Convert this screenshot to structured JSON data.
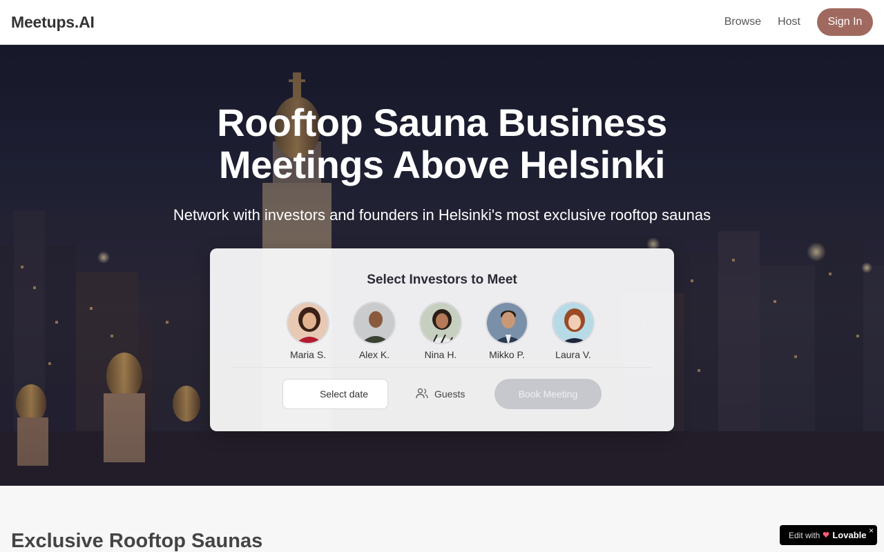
{
  "header": {
    "brand": "Meetups.AI",
    "nav": {
      "browse": "Browse",
      "host": "Host",
      "signin": "Sign In"
    }
  },
  "hero": {
    "title_line1": "Rooftop Sauna Business",
    "title_line2": "Meetings Above Helsinki",
    "subtitle": "Network with investors and founders in Helsinki's most exclusive rooftop saunas"
  },
  "booking": {
    "title": "Select Investors to Meet",
    "investors": [
      {
        "name": "Maria S."
      },
      {
        "name": "Alex K."
      },
      {
        "name": "Nina H."
      },
      {
        "name": "Mikko P."
      },
      {
        "name": "Laura V."
      }
    ],
    "date_label": "Select date",
    "guests_label": "Guests",
    "book_label": "Book Meeting"
  },
  "section": {
    "title": "Exclusive Rooftop Saunas"
  },
  "badge": {
    "prefix": "Edit with",
    "brand": "Lovable",
    "close": "×"
  },
  "colors": {
    "accent": "#a0695f",
    "disabled_button": "#c6c8ce"
  }
}
